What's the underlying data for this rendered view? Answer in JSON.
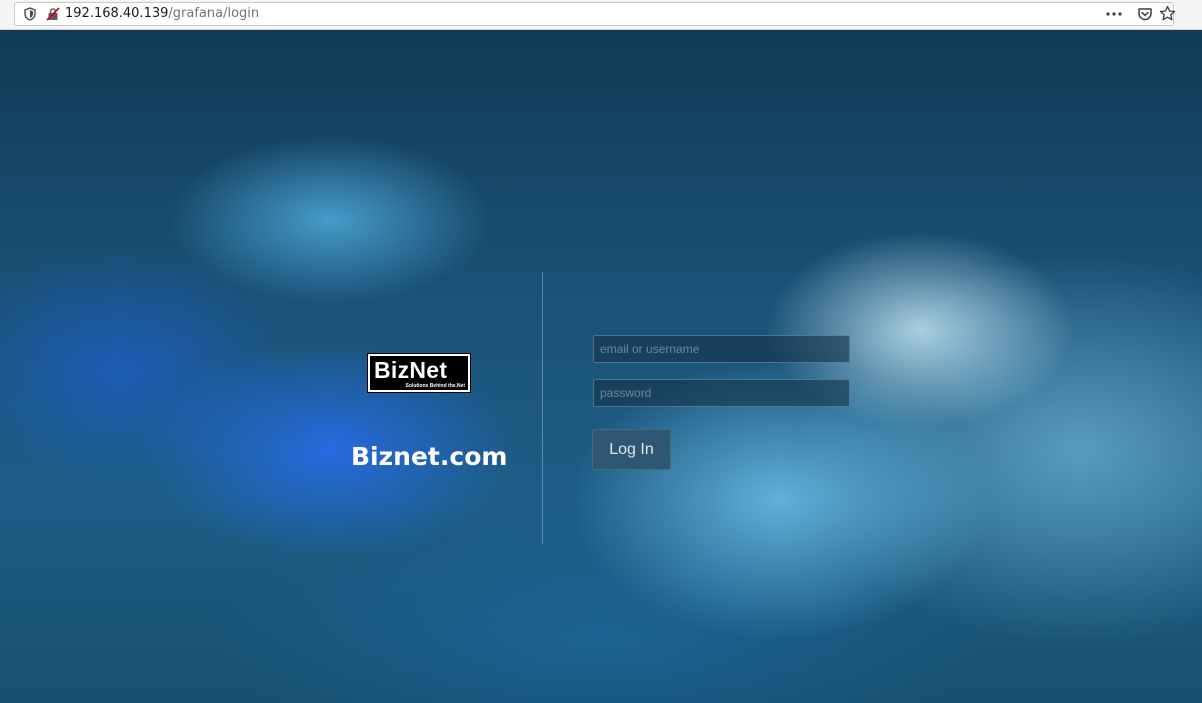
{
  "browser": {
    "url_host": "192.168.40.139",
    "url_path": "/grafana/login",
    "icons": {
      "tracking_protection": "shield-icon",
      "insecure_connection": "insecure-lock-icon",
      "page_actions": "more-icon",
      "save_to_pocket": "pocket-icon",
      "bookmark": "star-icon"
    }
  },
  "login": {
    "logo_text": "BizNet",
    "logo_tagline": "Solutions Behind the.Net",
    "brand_title": "Biznet.com",
    "username_placeholder": "email or username",
    "username_value": "",
    "password_placeholder": "password",
    "password_value": "",
    "submit_label": "Log In"
  },
  "colors": {
    "background_top": "#123a55",
    "background_mid": "#1d5d85",
    "button_bg": "#2f5673",
    "input_bg": "#163448",
    "brand_text": "#ffffff"
  }
}
